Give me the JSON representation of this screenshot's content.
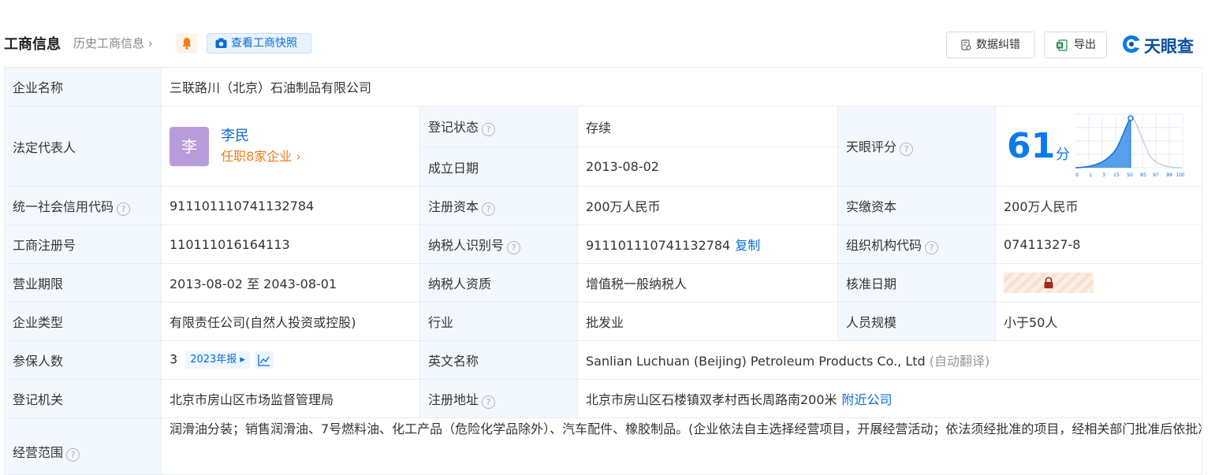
{
  "header": {
    "title": "工商信息",
    "history": "历史工商信息",
    "snapshot_button": "查看工商快照",
    "correct_button": "数据纠错",
    "export_button": "导出",
    "logo_text": "天眼查"
  },
  "company_name": {
    "label": "企业名称",
    "value": "三联路川（北京）石油制品有限公司"
  },
  "legal_rep": {
    "label": "法定代表人",
    "avatar_char": "李",
    "name": "李民",
    "jobs": "任职8家企业"
  },
  "reg_status": {
    "label": "登记状态",
    "value": "存续"
  },
  "found_date": {
    "label": "成立日期",
    "value": "2013-08-02"
  },
  "tianyan_score": {
    "label": "天眼评分",
    "score": "61",
    "unit": "分",
    "axis_ticks": [
      "0",
      "1",
      "3",
      "15",
      "50",
      "85",
      "97",
      "99",
      "100"
    ]
  },
  "credit_code": {
    "label": "统一社会信用代码",
    "value": "911101110741132784"
  },
  "reg_capital": {
    "label": "注册资本",
    "value": "200万人民币"
  },
  "paid_capital": {
    "label": "实缴资本",
    "value": "200万人民币"
  },
  "biz_reg_no": {
    "label": "工商注册号",
    "value": "110111016164113"
  },
  "taxpayer_id": {
    "label": "纳税人识别号",
    "value": "911101110741132784",
    "copy": "复制"
  },
  "org_code": {
    "label": "组织机构代码",
    "value": "07411327-8"
  },
  "biz_term": {
    "label": "营业期限",
    "value": "2013-08-02 至 2043-08-01"
  },
  "taxpayer_qual": {
    "label": "纳税人资质",
    "value": "增值税一般纳税人"
  },
  "approve_date": {
    "label": "核准日期"
  },
  "company_type": {
    "label": "企业类型",
    "value": "有限责任公司(自然人投资或控股)"
  },
  "industry": {
    "label": "行业",
    "value": "批发业"
  },
  "staff_size": {
    "label": "人员规模",
    "value": "小于50人"
  },
  "insured": {
    "label": "参保人数",
    "value": "3",
    "report": "2023年报"
  },
  "english_name": {
    "label": "英文名称",
    "value": "Sanlian Luchuan (Beijing) Petroleum Products Co., Ltd",
    "note": "(自动翻译)"
  },
  "reg_authority": {
    "label": "登记机关",
    "value": "北京市房山区市场监督管理局"
  },
  "reg_address": {
    "label": "注册地址",
    "value": "北京市房山区石楼镇双孝村西长周路南200米",
    "nearby": "附近公司"
  },
  "biz_scope": {
    "label": "经营范围",
    "value": "润滑油分装；销售润滑油、7号燃料油、化工产品（危险化学品除外）、汽车配件、橡胶制品。(企业依法自主选择经营项目，开展经营活动；依法须经批准的项目，经相关部门批准后依批准的内容开展经营活动；不得从事本市产业政策禁止和限制类项目的经营活动。)"
  },
  "icons": {
    "bell": "bell-icon",
    "camera": "camera-icon",
    "correct": "edit-doc-icon",
    "export": "excel-icon",
    "logo": "tianyancha-logo-icon",
    "question": "question-circle-icon",
    "lock": "lock-icon",
    "trend": "trend-chart-icon"
  }
}
